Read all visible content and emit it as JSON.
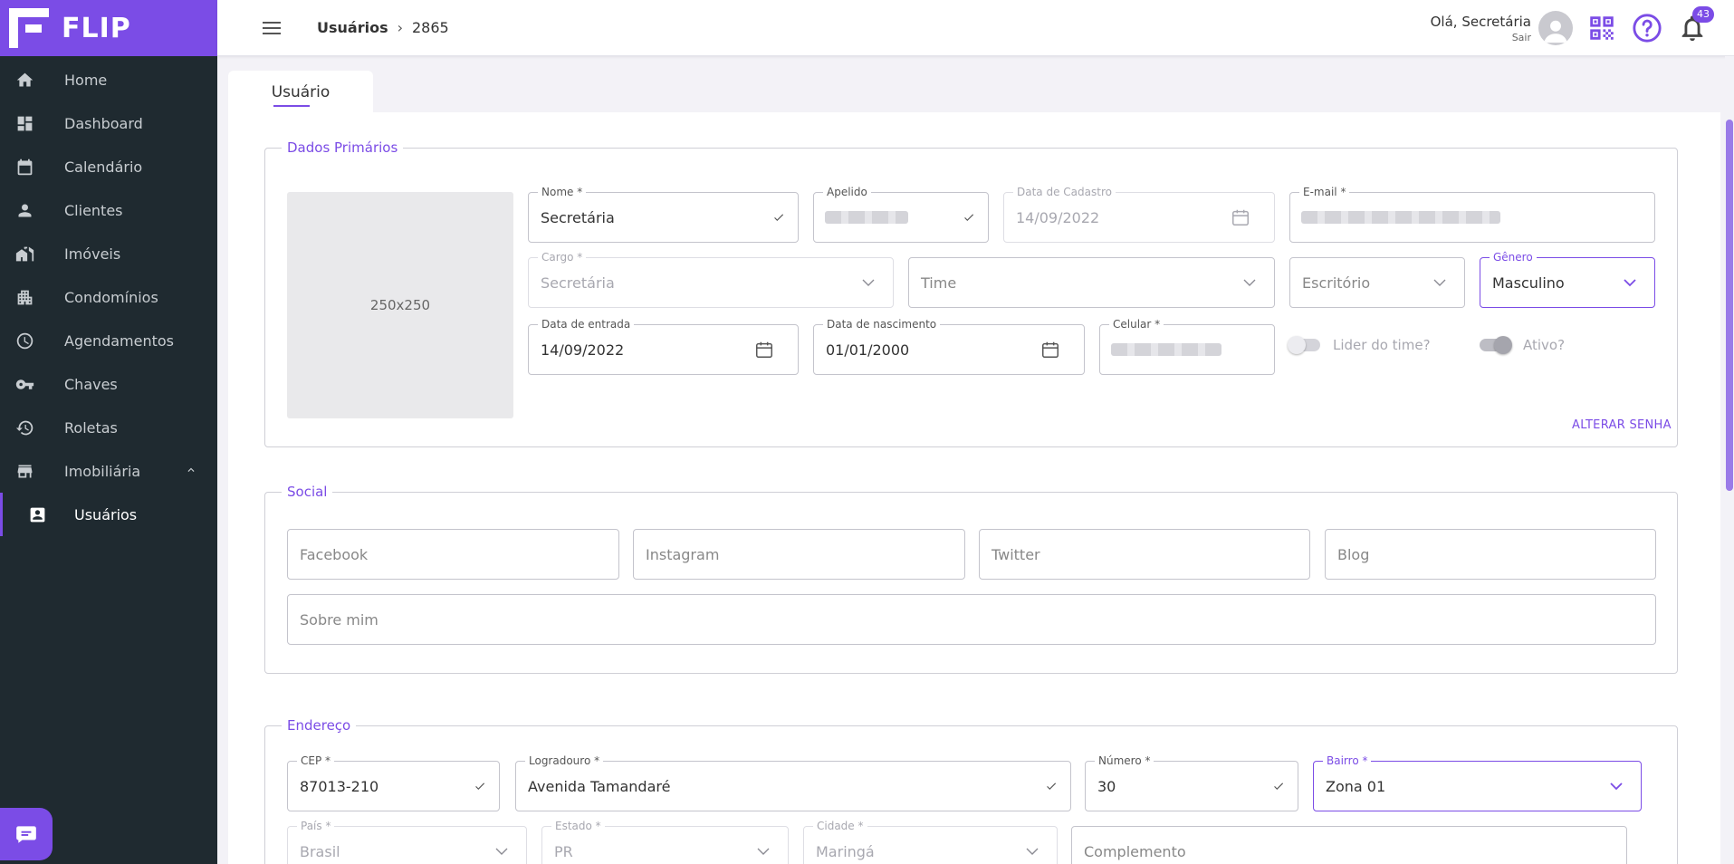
{
  "brand": {
    "name": "FLIP",
    "accent": "#7b4ce6"
  },
  "sidebar": {
    "items": [
      {
        "label": "Home",
        "icon": "home-icon"
      },
      {
        "label": "Dashboard",
        "icon": "dashboard-icon"
      },
      {
        "label": "Calendário",
        "icon": "calendar-icon"
      },
      {
        "label": "Clientes",
        "icon": "person-icon"
      },
      {
        "label": "Imóveis",
        "icon": "building-icon"
      },
      {
        "label": "Condomínios",
        "icon": "apartment-icon"
      },
      {
        "label": "Agendamentos",
        "icon": "clock-icon"
      },
      {
        "label": "Chaves",
        "icon": "key-icon"
      },
      {
        "label": "Roletas",
        "icon": "roulette-icon"
      },
      {
        "label": "Imobiliária",
        "icon": "store-icon"
      }
    ],
    "sub_items": [
      {
        "label": "Usuários",
        "icon": "contact-card-icon"
      }
    ]
  },
  "header": {
    "breadcrumb": [
      "Usuários",
      "2865"
    ],
    "greeting": "Olá, Secretária",
    "logout": "Sair",
    "notification_count": "43"
  },
  "tab": {
    "label": "Usuário"
  },
  "primary": {
    "legend": "Dados Primários",
    "image_placeholder": "250x250",
    "nome": {
      "label": "Nome *",
      "value": "Secretária"
    },
    "apelido": {
      "label": "Apelido"
    },
    "data_cadastro": {
      "label": "Data de Cadastro",
      "value": "14/09/2022"
    },
    "email": {
      "label": "E-mail *"
    },
    "cargo": {
      "label": "Cargo *",
      "value": "Secretária"
    },
    "time": {
      "placeholder": "Time"
    },
    "escritorio": {
      "placeholder": "Escritório"
    },
    "genero": {
      "label": "Gênero",
      "value": "Masculino"
    },
    "data_entrada": {
      "label": "Data de entrada",
      "value": "14/09/2022"
    },
    "data_nascimento": {
      "label": "Data de nascimento",
      "value": "01/01/2000"
    },
    "celular": {
      "label": "Celular *"
    },
    "lider": {
      "label": "Lider do time?",
      "checked": false
    },
    "ativo": {
      "label": "Ativo?",
      "checked": true
    },
    "change_password": "ALTERAR SENHA"
  },
  "social": {
    "legend": "Social",
    "facebook": "Facebook",
    "instagram": "Instagram",
    "twitter": "Twitter",
    "blog": "Blog",
    "about": "Sobre mim"
  },
  "address": {
    "legend": "Endereço",
    "cep": {
      "label": "CEP *",
      "value": "87013-210"
    },
    "logradouro": {
      "label": "Logradouro *",
      "value": "Avenida Tamandaré"
    },
    "numero": {
      "label": "Número *",
      "value": "30"
    },
    "bairro": {
      "label": "Bairro *",
      "value": "Zona 01"
    },
    "pais": {
      "label": "País *",
      "value": "Brasil"
    },
    "estado": {
      "label": "Estado *",
      "value": "PR"
    },
    "cidade": {
      "label": "Cidade *",
      "value": "Maringá"
    },
    "complemento": {
      "placeholder": "Complemento"
    }
  }
}
